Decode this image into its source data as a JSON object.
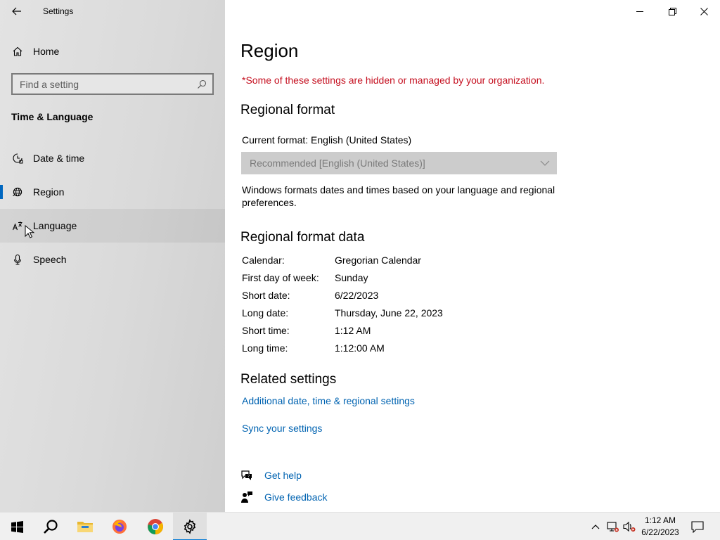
{
  "window": {
    "app_title": "Settings",
    "back_icon": "back-arrow-icon",
    "controls": [
      "minimize-icon",
      "restore-icon",
      "close-icon"
    ]
  },
  "sidebar": {
    "home_label": "Home",
    "search_placeholder": "Find a setting",
    "section_title": "Time & Language",
    "items": [
      {
        "label": "Date & time",
        "icon": "date-time-icon",
        "selected": false
      },
      {
        "label": "Region",
        "icon": "globe-region-icon",
        "selected": true
      },
      {
        "label": "Language",
        "icon": "language-icon",
        "selected": false,
        "hovered": true
      },
      {
        "label": "Speech",
        "icon": "microphone-icon",
        "selected": false
      }
    ]
  },
  "main": {
    "title": "Region",
    "managed_notice": "*Some of these settings are hidden or managed by your organization.",
    "regional_format": {
      "heading": "Regional format",
      "current_format": "Current format: English (United States)",
      "dropdown_value": "Recommended [English (United States)]",
      "description": "Windows formats dates and times based on your language and regional preferences."
    },
    "format_data": {
      "heading": "Regional format data",
      "rows": [
        {
          "key": "Calendar:",
          "value": "Gregorian Calendar"
        },
        {
          "key": "First day of week:",
          "value": "Sunday"
        },
        {
          "key": "Short date:",
          "value": "6/22/2023"
        },
        {
          "key": "Long date:",
          "value": "Thursday, June 22, 2023"
        },
        {
          "key": "Short time:",
          "value": "1:12 AM"
        },
        {
          "key": "Long time:",
          "value": "1:12:00 AM"
        }
      ]
    },
    "related": {
      "heading": "Related settings",
      "link1": "Additional date, time & regional settings",
      "link2": "Sync your settings"
    },
    "help": {
      "get_help": "Get help",
      "give_feedback": "Give feedback"
    }
  },
  "taskbar": {
    "apps": [
      "windows-start-icon",
      "search-icon",
      "file-explorer-icon",
      "firefox-icon",
      "chrome-icon",
      "settings-gear-icon"
    ],
    "time": "1:12 AM",
    "date": "6/22/2023"
  },
  "colors": {
    "accent": "#0067c0",
    "link": "#0063b1",
    "warning": "#c50f1f"
  }
}
